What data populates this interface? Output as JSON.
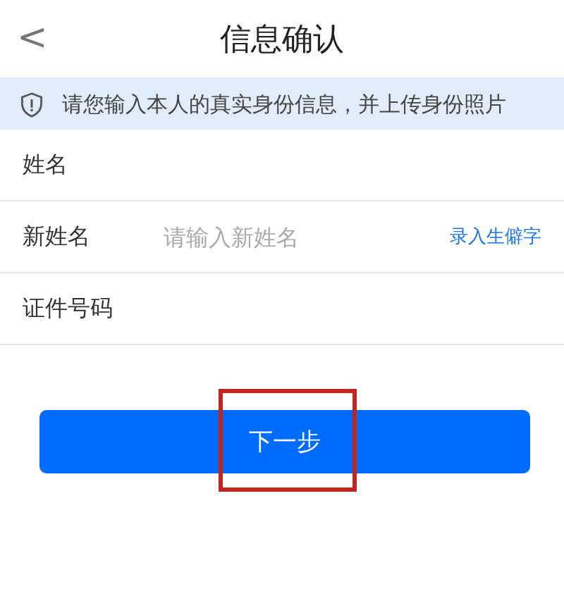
{
  "header": {
    "back_icon": "<",
    "title": "信息确认"
  },
  "notice": {
    "text": "请您输入本人的真实身份信息，并上传身份照片"
  },
  "fields": [
    {
      "kind": "plain",
      "label": "姓名"
    },
    {
      "kind": "input",
      "label": "新姓名",
      "placeholder": "请输入新姓名",
      "action": "录入生僻字"
    },
    {
      "kind": "plain",
      "label": "证件号码"
    }
  ],
  "button": {
    "label": "下一步",
    "highlighted": true
  }
}
